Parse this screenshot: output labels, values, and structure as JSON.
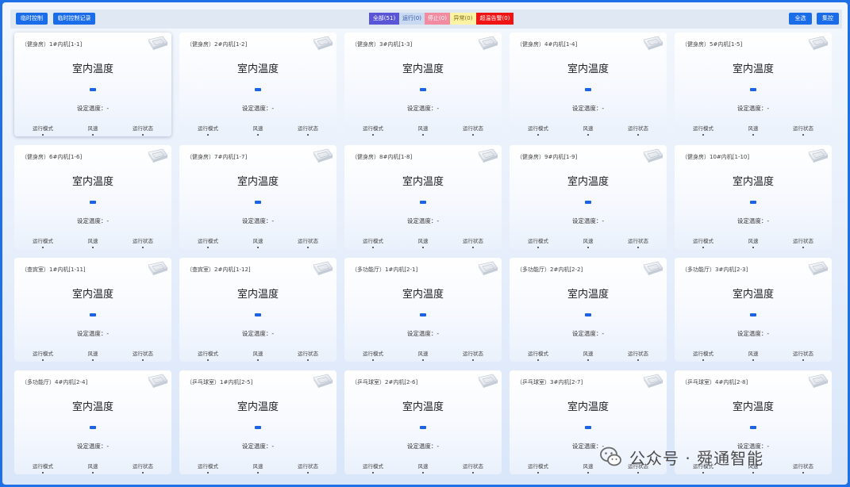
{
  "toolbar": {
    "temp_control_label": "临时控制",
    "temp_control_log_label": "临时控制记录",
    "select_all_label": "全选",
    "control_label": "集控"
  },
  "filters": {
    "all": "全部(51)",
    "running": "运行(0)",
    "stopped": "停止(0)",
    "error": "异常(0)",
    "over_temp_alarm": "超温告警(0)"
  },
  "card_labels": {
    "room_temp": "室内温度",
    "setpoint": "设定温度：-",
    "mode": "运行模式",
    "fan_speed": "风速",
    "status": "运行状态"
  },
  "cards": [
    {
      "title": "（健身房）1#内机[1-1]"
    },
    {
      "title": "（健身房）2#内机[1-2]"
    },
    {
      "title": "（健身房）3#内机[1-3]"
    },
    {
      "title": "（健身房）4#内机[1-4]"
    },
    {
      "title": "（健身房）5#内机[1-5]"
    },
    {
      "title": "（健身房）6#内机[1-6]"
    },
    {
      "title": "（健身房）7#内机[1-7]"
    },
    {
      "title": "（健身房）8#内机[1-8]"
    },
    {
      "title": "（健身房）9#内机[1-9]"
    },
    {
      "title": "（健身房）10#内机[1-10]"
    },
    {
      "title": "（查宾室）1#内机[1-11]"
    },
    {
      "title": "（查宾室）2#内机[1-12]"
    },
    {
      "title": "（多功能厅）1#内机[2-1]"
    },
    {
      "title": "（多功能厅）2#内机[2-2]"
    },
    {
      "title": "（多功能厅）3#内机[2-3]"
    },
    {
      "title": "（多功能厅）4#内机[2-4]"
    },
    {
      "title": "（乒乓球室）1#内机[2-5]"
    },
    {
      "title": "（乒乓球室）2#内机[2-6]"
    },
    {
      "title": "（乒乓球室）3#内机[2-7]"
    },
    {
      "title": "（乒乓球室）4#内机[2-8]"
    }
  ],
  "watermark": {
    "text": "公众号 · 舜通智能"
  },
  "colors": {
    "accent": "#1a6ce8",
    "all_chip": "#5a55d6",
    "stopped_chip": "#f28aa0",
    "error_chip": "#fff3a6",
    "alarm_chip": "#f01414",
    "temp_indicator": "#1a63e4"
  }
}
